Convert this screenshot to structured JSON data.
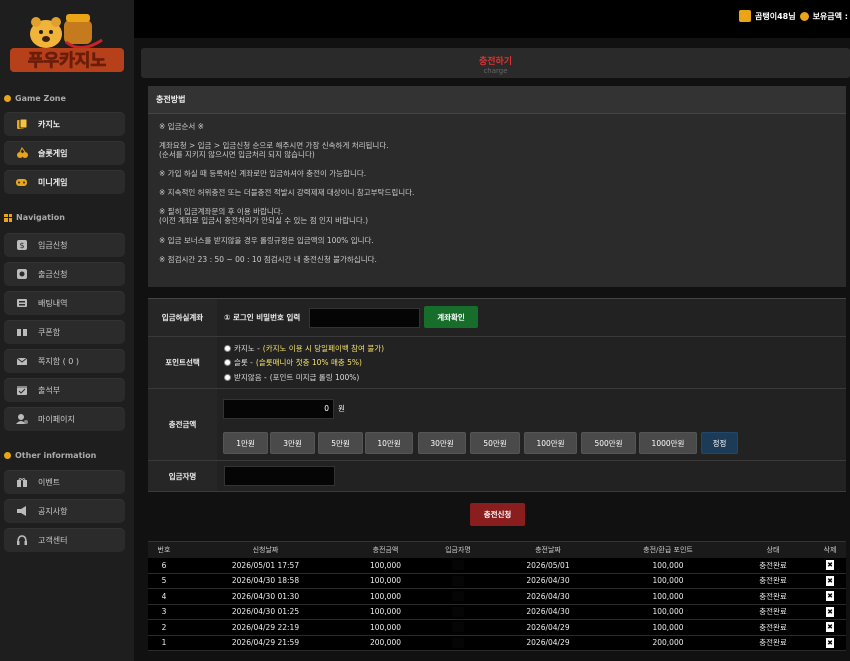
{
  "brand": {
    "name": "푸우카지노"
  },
  "user": {
    "nickname": "곰탱이48님",
    "balance_label": "보유금액 :"
  },
  "sidebar": {
    "game_zone_title": "Game Zone",
    "games": [
      {
        "label": "카지노",
        "icon": "cards-icon"
      },
      {
        "label": "슬롯게임",
        "icon": "slot-icon"
      },
      {
        "label": "미니게임",
        "icon": "gamepad-icon"
      }
    ],
    "navigation_title": "Navigation",
    "nav": [
      {
        "label": "입금신청",
        "icon": "deposit-icon"
      },
      {
        "label": "출금신청",
        "icon": "withdraw-icon"
      },
      {
        "label": "배팅내역",
        "icon": "betting-history-icon"
      },
      {
        "label": "쿠폰함",
        "icon": "coupon-icon"
      },
      {
        "label": "쪽지함 ( 0 )",
        "icon": "mail-icon"
      },
      {
        "label": "출석부",
        "icon": "attendance-icon"
      },
      {
        "label": "마이페이지",
        "icon": "user-icon"
      }
    ],
    "other_title": "Other information",
    "other": [
      {
        "label": "이벤트",
        "icon": "gift-icon"
      },
      {
        "label": "공지사항",
        "icon": "megaphone-icon"
      },
      {
        "label": "고객센터",
        "icon": "headset-icon"
      }
    ]
  },
  "page": {
    "title": "충전하기",
    "subtitle": "charge"
  },
  "method": {
    "heading": "충전방법",
    "lines": [
      "※ 입금순서 ※",
      "계좌요청 > 입금 > 입금신청 순으로 해주시면 가장 신속하게 처리됩니다.",
      "(순서를 지키지 않으시면 입금처리 되지 않습니다)",
      "※ 가입 하실 때 등록하신 계좌로만 입금하셔야 충전이 가능합니다.",
      "※ 지속적인 허위충전 또는 더블충전 적발시 강력제재 대상이니 참고부탁드립니다.",
      "※ 필히 입금계좌문의 후 이용 바랍니다.",
      "(이전 계좌로 입금시 충전처리가 안되실 수 있는 점 인지 바랍니다.)",
      "※ 입금 보너스를 받지않을 경우 롤링규정은 입금액의 100% 입니다.",
      "※ 점검시간 23 : 50 ~ 00 : 10 점검시간 내 충전신청 불가하십니다."
    ]
  },
  "form": {
    "account_label": "입금하실계좌",
    "login_pw_label": "① 로그인 비밀번호 입력",
    "login_pw_value": "",
    "confirm_button": "계좌확인",
    "point_label": "포인트선택",
    "point_options": [
      {
        "name": "카지노 - ",
        "detail": "(카지노 이용 시 당일페이백 참여 불가)"
      },
      {
        "name": "슬롯 - ",
        "detail": "(슬롯매니아 첫충 10% 매충 5%)"
      },
      {
        "name": "받지않음 - ",
        "detail": "(포인트 미지급 롤링 100%)"
      }
    ],
    "amount_label": "충전금액",
    "amount_value": "0",
    "amount_unit": "원",
    "amount_buttons": [
      "1만원",
      "3만원",
      "5만원",
      "10만원",
      "30만원",
      "50만원",
      "100만원",
      "500만원",
      "1000만원"
    ],
    "reset_button": "정정",
    "depositor_label": "입금자명",
    "submit_button": "충전신청"
  },
  "history": {
    "headers": [
      "번호",
      "신청날짜",
      "충전금액",
      "입금자명",
      "충전날짜",
      "충전/환급 포인트",
      "상태",
      "삭제"
    ],
    "rows": [
      {
        "no": "6",
        "req_date": "2026/05/01 17:57",
        "amount": "100,000",
        "charge_date": "2026/05/01",
        "point": "100,000",
        "status": "충전완료"
      },
      {
        "no": "5",
        "req_date": "2026/04/30 18:58",
        "amount": "100,000",
        "charge_date": "2026/04/30",
        "point": "100,000",
        "status": "충전완료"
      },
      {
        "no": "4",
        "req_date": "2026/04/30 01:30",
        "amount": "100,000",
        "charge_date": "2026/04/30",
        "point": "100,000",
        "status": "충전완료"
      },
      {
        "no": "3",
        "req_date": "2026/04/30 01:25",
        "amount": "100,000",
        "charge_date": "2026/04/30",
        "point": "100,000",
        "status": "충전완료"
      },
      {
        "no": "2",
        "req_date": "2026/04/29 22:19",
        "amount": "100,000",
        "charge_date": "2026/04/29",
        "point": "100,000",
        "status": "충전완료"
      },
      {
        "no": "1",
        "req_date": "2026/04/29 21:59",
        "amount": "200,000",
        "charge_date": "2026/04/29",
        "point": "200,000",
        "status": "충전완료"
      }
    ],
    "delete_glyph": "✖"
  },
  "colors": {
    "accent": "#e9a516",
    "title_red": "#dd3333",
    "green": "#166e2a",
    "submit_red": "#8a1d1d",
    "highlight_yellow": "#f3e16a"
  }
}
